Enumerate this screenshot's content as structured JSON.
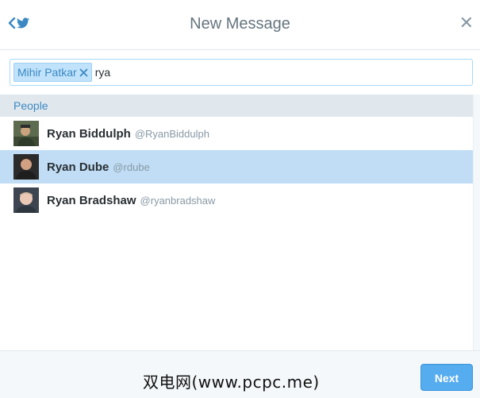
{
  "header": {
    "title": "New Message",
    "back_icon": "chevron-left-icon",
    "bird_icon": "twitter-bird-icon",
    "close_glyph": "✕"
  },
  "to_field": {
    "token_label": "Mihir Patkar",
    "query": "rya"
  },
  "section": {
    "label": "People"
  },
  "results": [
    {
      "name": "Ryan Biddulph",
      "handle": "@RyanBiddulph",
      "selected": false
    },
    {
      "name": "Ryan Dube",
      "handle": "@rdube",
      "selected": true
    },
    {
      "name": "Ryan Bradshaw",
      "handle": "@ryanbradshaw",
      "selected": false
    }
  ],
  "footer": {
    "watermark": "双电网(www.pcpc.me)",
    "next_label": "Next"
  },
  "colors": {
    "accent": "#55acee",
    "selected_row": "#c0ddf5",
    "token_bg": "#c0e3fb"
  }
}
